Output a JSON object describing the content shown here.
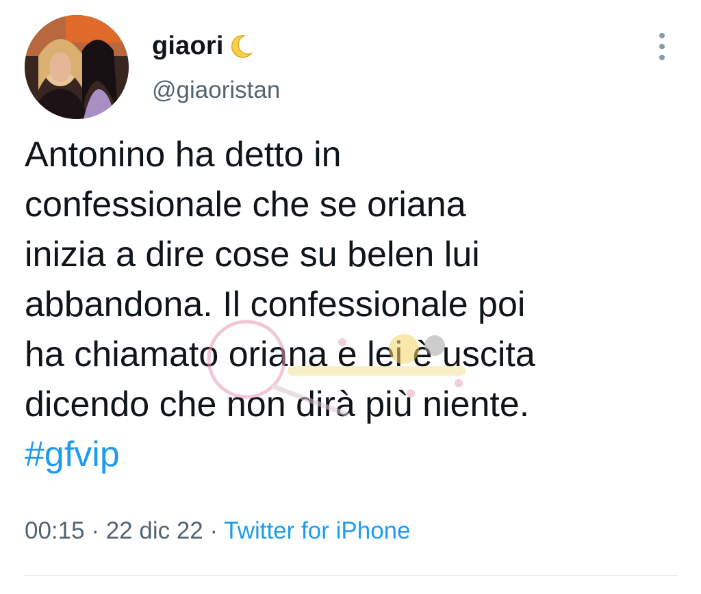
{
  "user": {
    "display_name": "giaori",
    "name_emoji": "crescent-moon-icon",
    "handle": "@giaoristan",
    "avatar": "profile-photo"
  },
  "tweet": {
    "lines": [
      "Antonino ha detto in",
      "confessionale che se oriana",
      "inizia a dire cose su belen lui",
      "abbandona. Il confessionale poi",
      "ha chiamato oriana e lei è uscita",
      "dicendo che non dirà più niente."
    ],
    "hashtag": "#gfvip"
  },
  "meta": {
    "time": "00:15",
    "separator": "·",
    "date": "22 dic 22",
    "source": "Twitter for iPhone"
  },
  "colors": {
    "link": "#1d9bf0",
    "secondary_text": "#536471",
    "primary_text": "#0f1419"
  },
  "icons": {
    "more_menu": "more-vertical-icon"
  }
}
